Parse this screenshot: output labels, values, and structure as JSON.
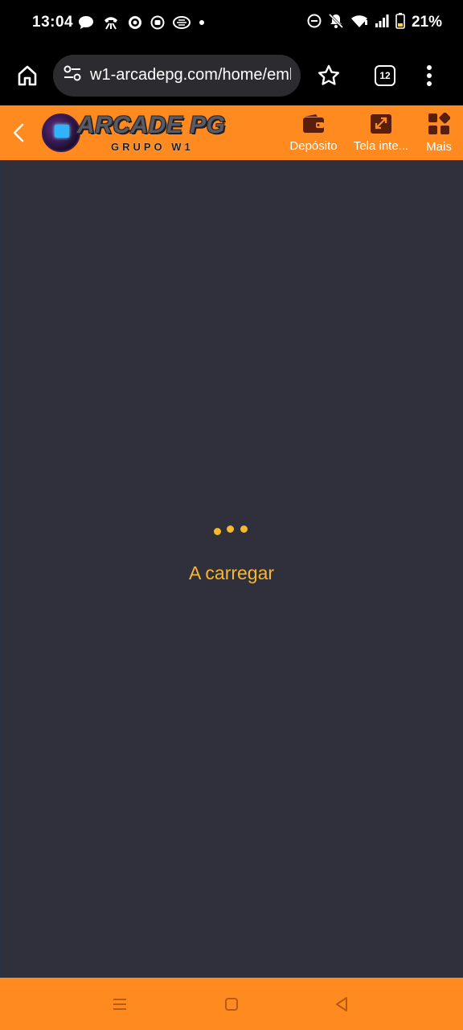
{
  "status_bar": {
    "time": "13:04",
    "battery": "21%",
    "left_icons": [
      "chat-bubble-icon",
      "phone-link-icon",
      "shield-app-icon",
      "record-app-icon",
      "pay-app-icon",
      "dot-icon"
    ],
    "right_icons": [
      "dnd-icon",
      "bell-off-icon",
      "wifi-icon",
      "signal-icon",
      "battery-icon"
    ]
  },
  "browser": {
    "url": "w1-arcadepg.com/home/emb",
    "tab_count": "12"
  },
  "app_header": {
    "logo_title": "ARCADE PG",
    "logo_subtitle": "GRUPO W1",
    "actions": [
      {
        "label": "Depósito",
        "icon": "wallet-icon"
      },
      {
        "label": "Tela inte...",
        "icon": "expand-icon"
      },
      {
        "label": "Mais",
        "icon": "grid-icon"
      }
    ]
  },
  "content": {
    "loading_text": "A carregar"
  },
  "colors": {
    "header_bg": "#ff8a1f",
    "content_bg": "#30303c",
    "loader": "#f5b82e",
    "icon_dark": "#5a1e0c"
  }
}
